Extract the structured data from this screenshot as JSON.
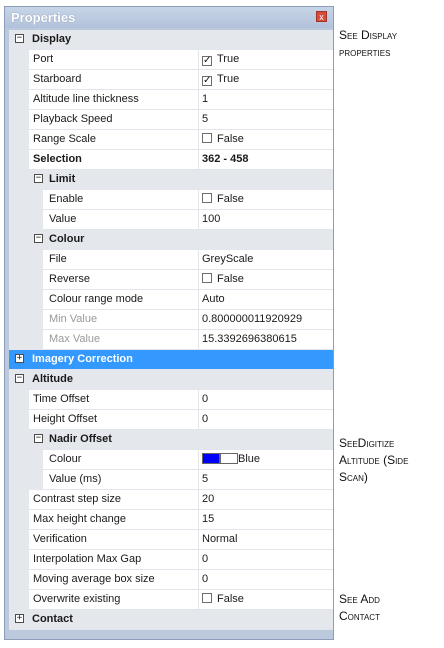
{
  "panel": {
    "title": "Properties",
    "close_glyph": "x"
  },
  "rows": [
    {
      "kind": "cat",
      "indent": 0,
      "expander": "⊟",
      "label": "Display"
    },
    {
      "kind": "prop",
      "indent": 0,
      "label": "Port",
      "value_type": "check",
      "checked": true,
      "value": "True"
    },
    {
      "kind": "prop",
      "indent": 0,
      "label": "Starboard",
      "value_type": "check",
      "checked": true,
      "value": "True"
    },
    {
      "kind": "prop",
      "indent": 0,
      "label": "Altitude line thickness",
      "value": "1"
    },
    {
      "kind": "prop",
      "indent": 0,
      "label": "Playback Speed",
      "value": "5"
    },
    {
      "kind": "prop",
      "indent": 0,
      "label": "Range Scale",
      "value_type": "check",
      "checked": false,
      "value": "False"
    },
    {
      "kind": "prop",
      "indent": 0,
      "label": "Selection",
      "value": "362 - 458",
      "bold": true
    },
    {
      "kind": "sub",
      "indent": 1,
      "expander": "⊟",
      "label": "Limit"
    },
    {
      "kind": "prop",
      "indent": 1,
      "label": "Enable",
      "value_type": "check",
      "checked": false,
      "value": "False"
    },
    {
      "kind": "prop",
      "indent": 1,
      "label": "Value",
      "value": "100"
    },
    {
      "kind": "sub",
      "indent": 1,
      "expander": "⊟",
      "label": "Colour"
    },
    {
      "kind": "prop",
      "indent": 1,
      "label": "File",
      "value": "GreyScale"
    },
    {
      "kind": "prop",
      "indent": 1,
      "label": "Reverse",
      "value_type": "check",
      "checked": false,
      "value": "False"
    },
    {
      "kind": "prop",
      "indent": 1,
      "label": "Colour range mode",
      "value": "Auto"
    },
    {
      "kind": "prop",
      "indent": 1,
      "label": "Min Value",
      "value": "0.800000011920929",
      "dim": true
    },
    {
      "kind": "prop",
      "indent": 1,
      "label": "Max Value",
      "value": "15.3392696380615",
      "dim": true
    },
    {
      "kind": "cat",
      "indent": 0,
      "expander": "⊞",
      "label": "Imagery Correction",
      "highlight": true
    },
    {
      "kind": "cat",
      "indent": 0,
      "expander": "⊟",
      "label": "Altitude"
    },
    {
      "kind": "prop",
      "indent": 0,
      "label": "Time Offset",
      "value": "0"
    },
    {
      "kind": "prop",
      "indent": 0,
      "label": "Height Offset",
      "value": "0"
    },
    {
      "kind": "sub",
      "indent": 1,
      "expander": "⊟",
      "label": "Nadir Offset"
    },
    {
      "kind": "prop",
      "indent": 1,
      "label": "Colour",
      "value_type": "color",
      "swatches": [
        "#0000ff",
        "#ffffff"
      ],
      "value": "Blue"
    },
    {
      "kind": "prop",
      "indent": 1,
      "label": "Value (ms)",
      "value": "5"
    },
    {
      "kind": "prop",
      "indent": 0,
      "label": "Contrast step size",
      "value": "20"
    },
    {
      "kind": "prop",
      "indent": 0,
      "label": "Max height change",
      "value": "15"
    },
    {
      "kind": "prop",
      "indent": 0,
      "label": "Verification",
      "value": "Normal"
    },
    {
      "kind": "prop",
      "indent": 0,
      "label": "Interpolation Max Gap",
      "value": "0"
    },
    {
      "kind": "prop",
      "indent": 0,
      "label": "Moving average box size",
      "value": "0"
    },
    {
      "kind": "prop",
      "indent": 0,
      "label": "Overwrite existing",
      "value_type": "check",
      "checked": false,
      "value": "False"
    },
    {
      "kind": "cat",
      "indent": 0,
      "expander": "⊞",
      "label": "Contact"
    }
  ],
  "notes": [
    {
      "lines": [
        "See Display",
        "properties"
      ]
    },
    {
      "lines": [
        "SeeDigitize",
        "Altitude (Side",
        "Scan)"
      ]
    },
    {
      "lines": [
        "See Add",
        "Contact"
      ]
    }
  ]
}
